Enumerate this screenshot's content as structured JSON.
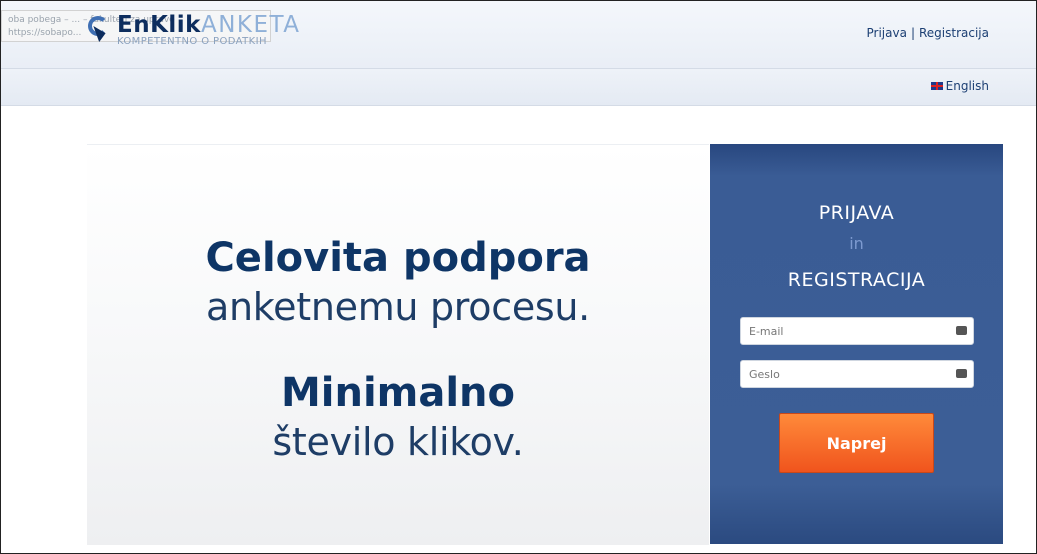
{
  "tooltip": {
    "line1": "oba pobega – ... – fakulteti za upravo",
    "line2": "https://sobapo..."
  },
  "logo": {
    "brand": "EnKlik",
    "product": "ANKETA",
    "tagline": "KOMPETENTNO O PODATKIH"
  },
  "header": {
    "login_link": "Prijava",
    "separator": "|",
    "register_link": "Registracija"
  },
  "subbar": {
    "language": "English"
  },
  "hero": {
    "line1_bold": "Celovita podpora",
    "line1_light": "anketnemu procesu.",
    "line2_bold": "Minimalno",
    "line2_light": "število klikov."
  },
  "panel": {
    "title1": "PRIJAVA",
    "title2": "in",
    "title3": "REGISTRACIJA",
    "email_placeholder": "E-mail",
    "password_placeholder": "Geslo",
    "submit_label": "Naprej"
  },
  "colors": {
    "navy": "#0e3566",
    "panel_blue": "#3c5e96",
    "accent_orange": "#f0541d"
  }
}
